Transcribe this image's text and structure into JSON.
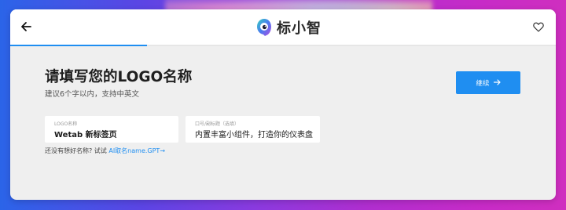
{
  "header": {
    "app_name": "标小智",
    "back_icon": "arrow-left-icon",
    "favorite_icon": "heart-outline-icon",
    "progress": 0.25
  },
  "main": {
    "title": "请填写您的LOGO名称",
    "subtitle": "建议6个字以内，支持中英文",
    "continue_label": "继续",
    "continue_icon": "arrow-right-icon"
  },
  "form": {
    "name_field": {
      "label": "LOGO名称",
      "value": "Wetab 新标签页"
    },
    "slogan_field": {
      "label": "口号/副标题（选填）",
      "value": "内置丰富小组件，打造你的仪表盘"
    }
  },
  "hint": {
    "text": "还没有想好名称?  试试",
    "link": "AI取名name.GPT→"
  },
  "colors": {
    "accent": "#1f8ef1",
    "panel": "#efefef",
    "background_start": "#2b64e8",
    "background_end": "#cf2fbf"
  }
}
